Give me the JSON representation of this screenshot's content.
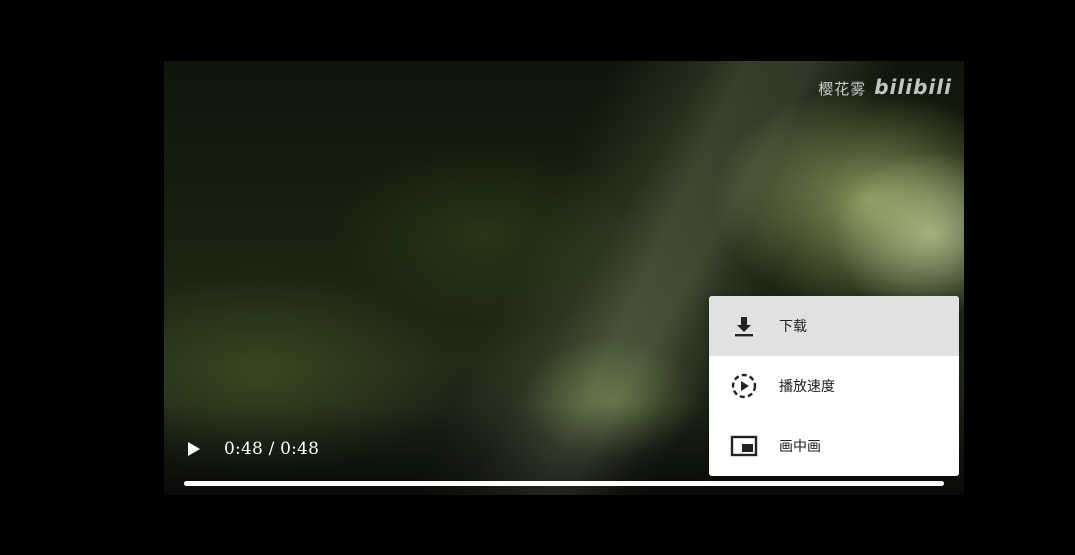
{
  "player": {
    "watermark_text": "樱花雾",
    "watermark_brand": "bilibili",
    "time_display": "0:48 / 0:48",
    "progress_fraction": 1.0
  },
  "menu": {
    "items": [
      {
        "label": "下载",
        "icon": "download-icon",
        "highlighted": true
      },
      {
        "label": "播放速度",
        "icon": "playback-speed-icon",
        "highlighted": false
      },
      {
        "label": "画中画",
        "icon": "picture-in-picture-icon",
        "highlighted": false
      }
    ]
  },
  "colors": {
    "menu_background": "#ffffff",
    "menu_highlight": "#e1e1e1",
    "progress_fill": "#ffffff"
  }
}
